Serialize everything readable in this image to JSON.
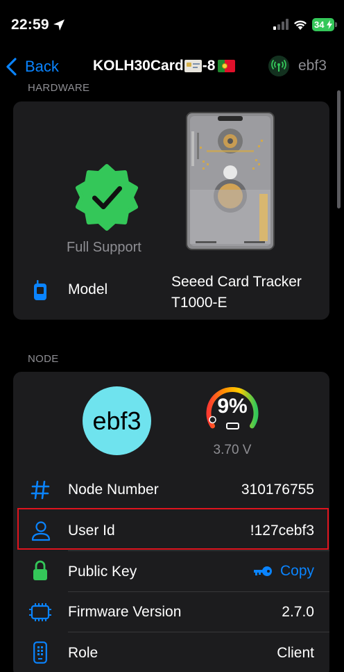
{
  "status_bar": {
    "time": "22:59",
    "battery": "34"
  },
  "nav": {
    "back_label": "Back",
    "title_prefix": "KOLH30Card",
    "title_suffix": "-8",
    "short_name": "ebf3"
  },
  "hardware": {
    "section_header": "HARDWARE",
    "support_label": "Full Support",
    "model_label": "Model",
    "model_value_line1": "Seeed Card Tracker",
    "model_value_line2": "T1000-E"
  },
  "node": {
    "section_header": "NODE",
    "avatar_text": "ebf3",
    "battery_percent": "9%",
    "battery_level": 0.09,
    "voltage": "3.70 V",
    "rows": [
      {
        "label": "Node Number",
        "value": "310176755",
        "icon": "hash-icon"
      },
      {
        "label": "User Id",
        "value": "!127cebf3",
        "icon": "person-icon"
      },
      {
        "label": "Public Key",
        "value": "Copy",
        "icon": "lock-icon"
      },
      {
        "label": "Firmware Version",
        "value": "2.7.0",
        "icon": "chip-icon"
      },
      {
        "label": "Role",
        "value": "Client",
        "icon": "device-icon"
      }
    ]
  },
  "colors": {
    "accent": "#0a84ff",
    "verified_green": "#34c759",
    "avatar_bg": "#6fe3ee",
    "highlight": "#e0141e",
    "card_bg": "#1c1c1e"
  }
}
